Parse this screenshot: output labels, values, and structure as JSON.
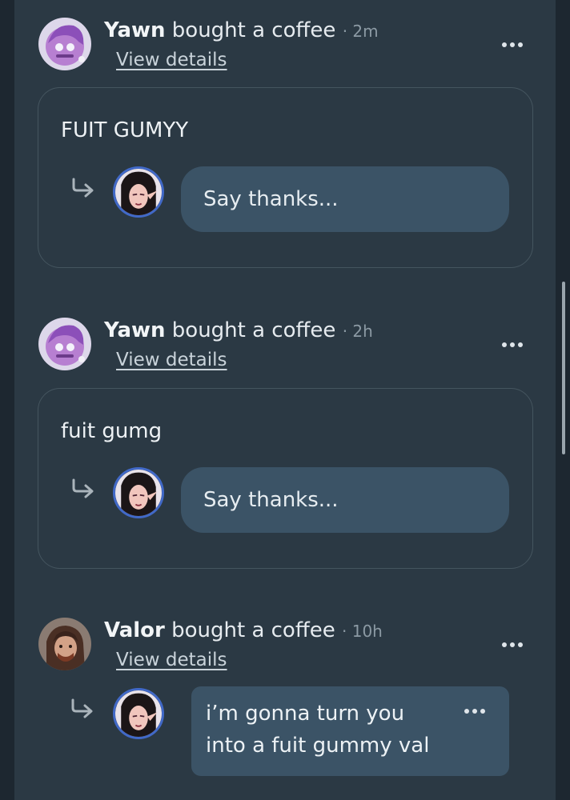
{
  "posts": [
    {
      "name": "Yawn",
      "action": "bought a coffee",
      "time": "· 2m",
      "details_label": "View details",
      "message": "FUIT GUMYY",
      "reply_placeholder": "Say thanks..."
    },
    {
      "name": "Yawn",
      "action": "bought a coffee",
      "time": "· 2h",
      "details_label": "View details",
      "message": "fuit gumg",
      "reply_placeholder": "Say thanks..."
    },
    {
      "name": "Valor",
      "action": "bought a coffee",
      "time": "· 10h",
      "details_label": "View details",
      "reply_line1": "i’m gonna turn you",
      "reply_line2": "into a fuit gummy val"
    }
  ],
  "icons": {
    "more": "more-horizontal-icon",
    "reply": "reply-arrow-icon"
  },
  "colors": {
    "background": "#2b3944",
    "input": "#3b5366",
    "avatar_ring": "#4169c8"
  }
}
